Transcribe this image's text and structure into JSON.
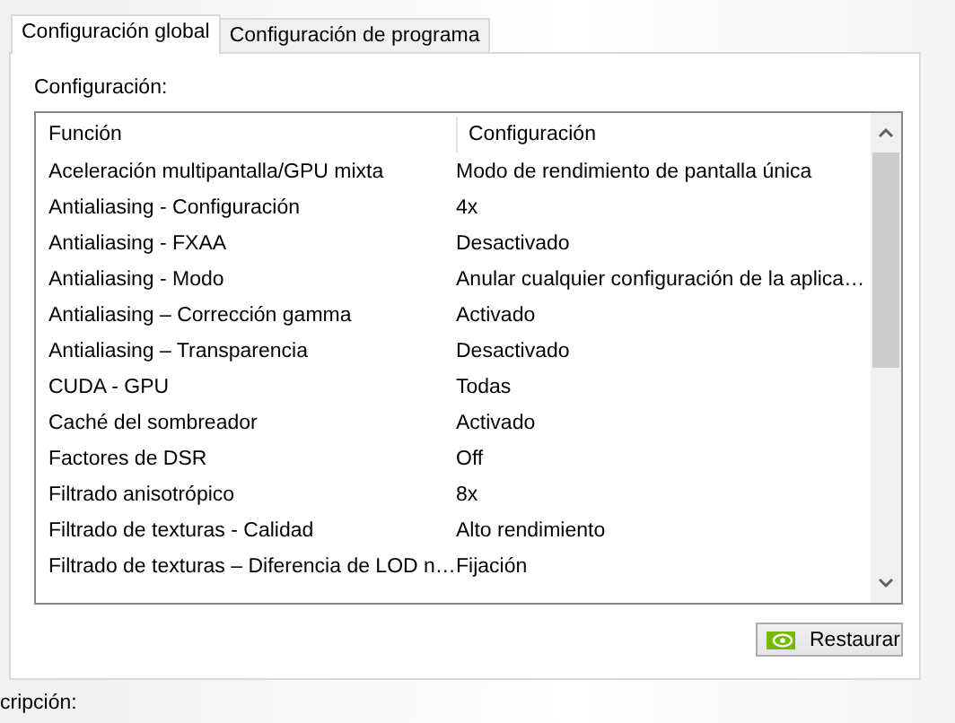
{
  "tabs": [
    {
      "label": "Configuración global",
      "selected": true
    },
    {
      "label": "Configuración de programa",
      "selected": false
    }
  ],
  "section_label": "Configuración:",
  "table": {
    "columns": [
      "Función",
      "Configuración"
    ],
    "rows": [
      [
        "Aceleración multipantalla/GPU mixta",
        "Modo de rendimiento de pantalla única"
      ],
      [
        "Antialiasing - Configuración",
        "4x"
      ],
      [
        "Antialiasing - FXAA",
        "Desactivado"
      ],
      [
        "Antialiasing - Modo",
        "Anular cualquier configuración de la aplica…"
      ],
      [
        "Antialiasing – Corrección gamma",
        "Activado"
      ],
      [
        "Antialiasing – Transparencia",
        "Desactivado"
      ],
      [
        "CUDA - GPU",
        "Todas"
      ],
      [
        "Caché del sombreador",
        "Activado"
      ],
      [
        "Factores de DSR",
        "Off"
      ],
      [
        "Filtrado anisotrópico",
        "8x"
      ],
      [
        "Filtrado de texturas - Calidad",
        "Alto rendimiento"
      ],
      [
        "Filtrado de texturas – Diferencia de LOD n…",
        "Fijación"
      ]
    ]
  },
  "restore_button": "Restaurar",
  "description_label": "cripción:"
}
